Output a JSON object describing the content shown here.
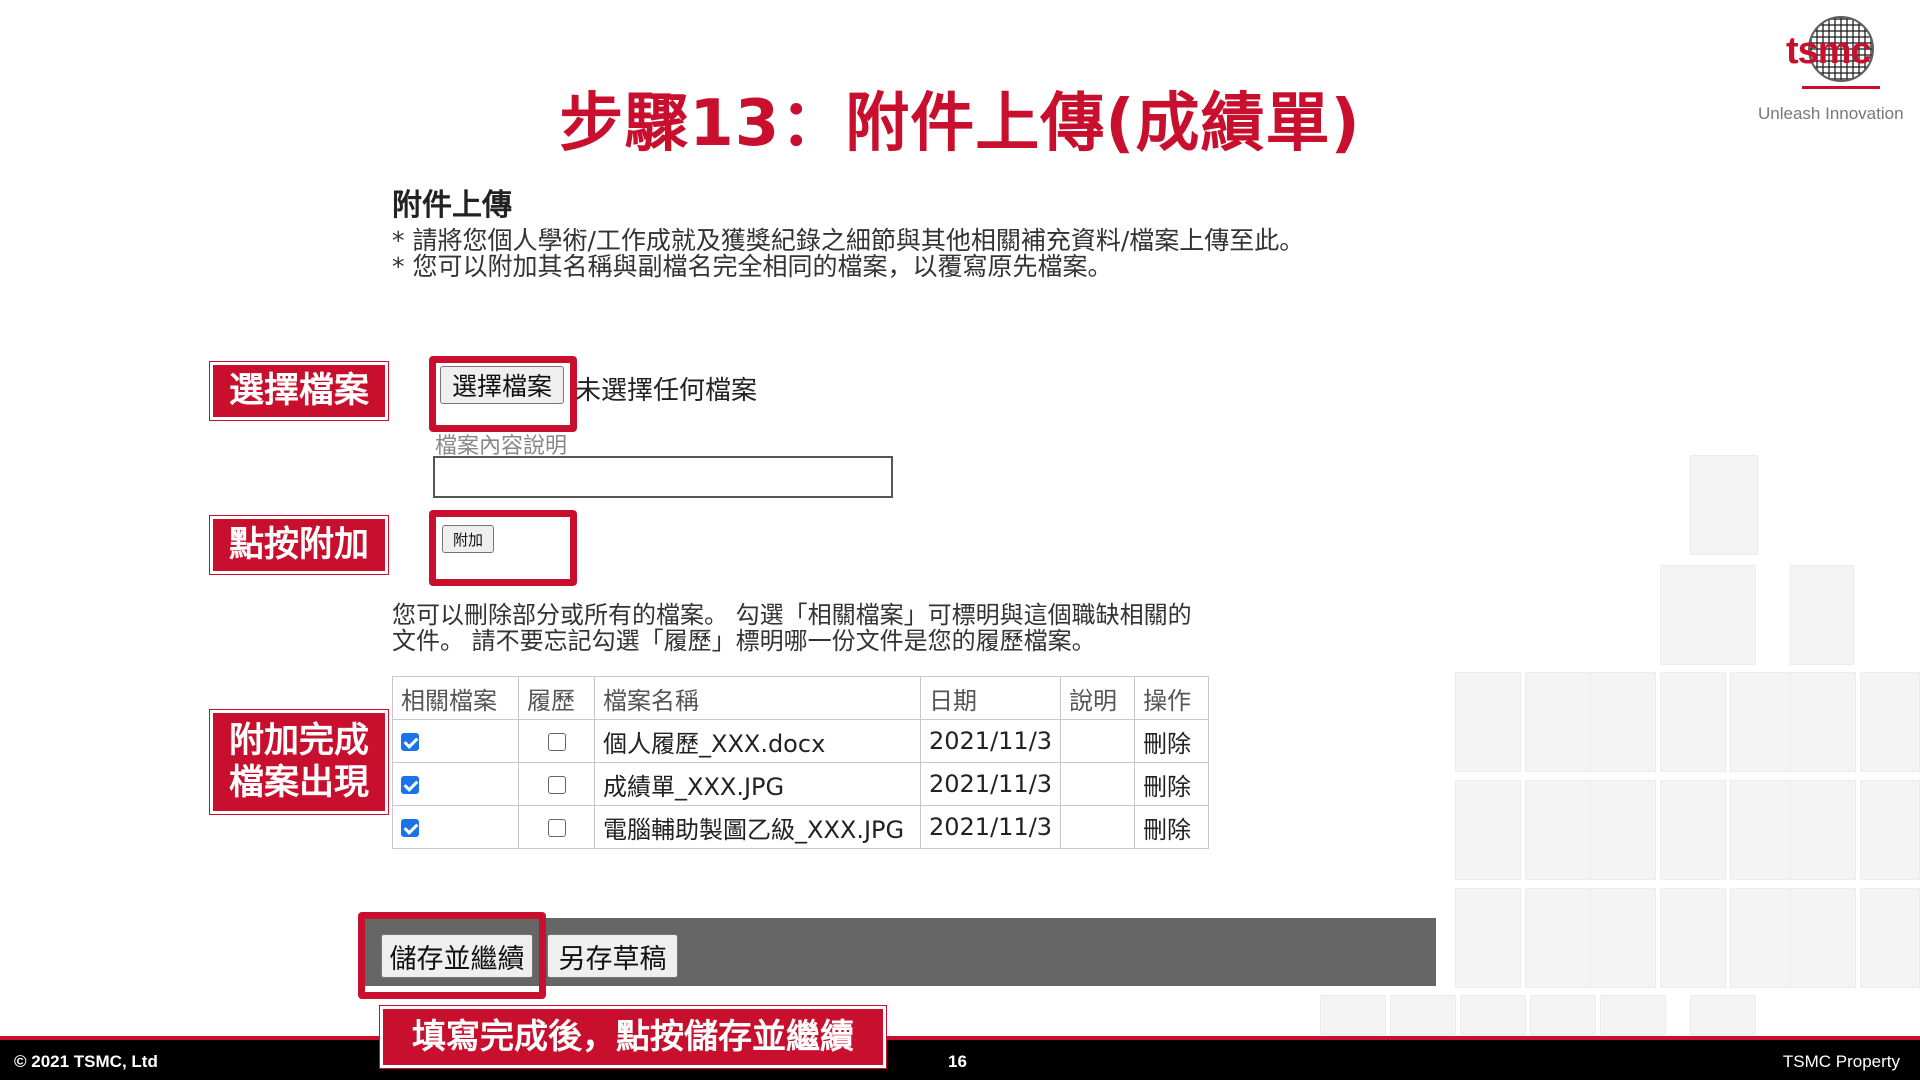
{
  "slide": {
    "title": "步驟13：附件上傳(成績單)",
    "tagline": "Unleash Innovation",
    "logo_text": "tsmc"
  },
  "form": {
    "heading": "附件上傳",
    "notes": [
      "* 請將您個人學術/工作成就及獲獎紀錄之細節與其他相關補充資料/檔案上傳至此。",
      "* 您可以附加其名稱與副檔名完全相同的檔案，以覆寫原先檔案。"
    ],
    "choose_file_label": "選擇檔案",
    "file_status": "未選擇任何檔案",
    "description_label": "檔案內容說明",
    "description_value": "",
    "attach_label": "附加",
    "delete_note": "您可以刪除部分或所有的檔案。 勾選「相關檔案」可標明與這個職缺相關的文件。 請不要忘記勾選「履歷」標明哪一份文件是您的履歷檔案。"
  },
  "table": {
    "headers": [
      "相關檔案",
      "履歷",
      "檔案名稱",
      "日期",
      "說明",
      "操作"
    ],
    "rows": [
      {
        "relevant": true,
        "resume": false,
        "name": "個人履歷_XXX.docx",
        "date": "2021/11/3",
        "desc": "",
        "action": "刪除"
      },
      {
        "relevant": true,
        "resume": false,
        "name": "成績單_XXX.JPG",
        "date": "2021/11/3",
        "desc": "",
        "action": "刪除"
      },
      {
        "relevant": true,
        "resume": false,
        "name": "電腦輔助製圖乙級_XXX.JPG",
        "date": "2021/11/3",
        "desc": "",
        "action": "刪除"
      }
    ]
  },
  "actions": {
    "save_continue": "儲存並繼續",
    "save_draft": "另存草稿"
  },
  "callouts": {
    "choose": "選擇檔案",
    "attach": "點按附加",
    "done_1": "附加完成",
    "done_2": "檔案出現",
    "save": "填寫完成後，點按儲存並繼續"
  },
  "footer": {
    "copyright": "© 2021 TSMC, Ltd",
    "page": "16",
    "property": "TSMC Property"
  },
  "colors": {
    "brand_red": "#c8102e",
    "bar_gray": "#666666",
    "checkbox_blue": "#1a73e8"
  }
}
